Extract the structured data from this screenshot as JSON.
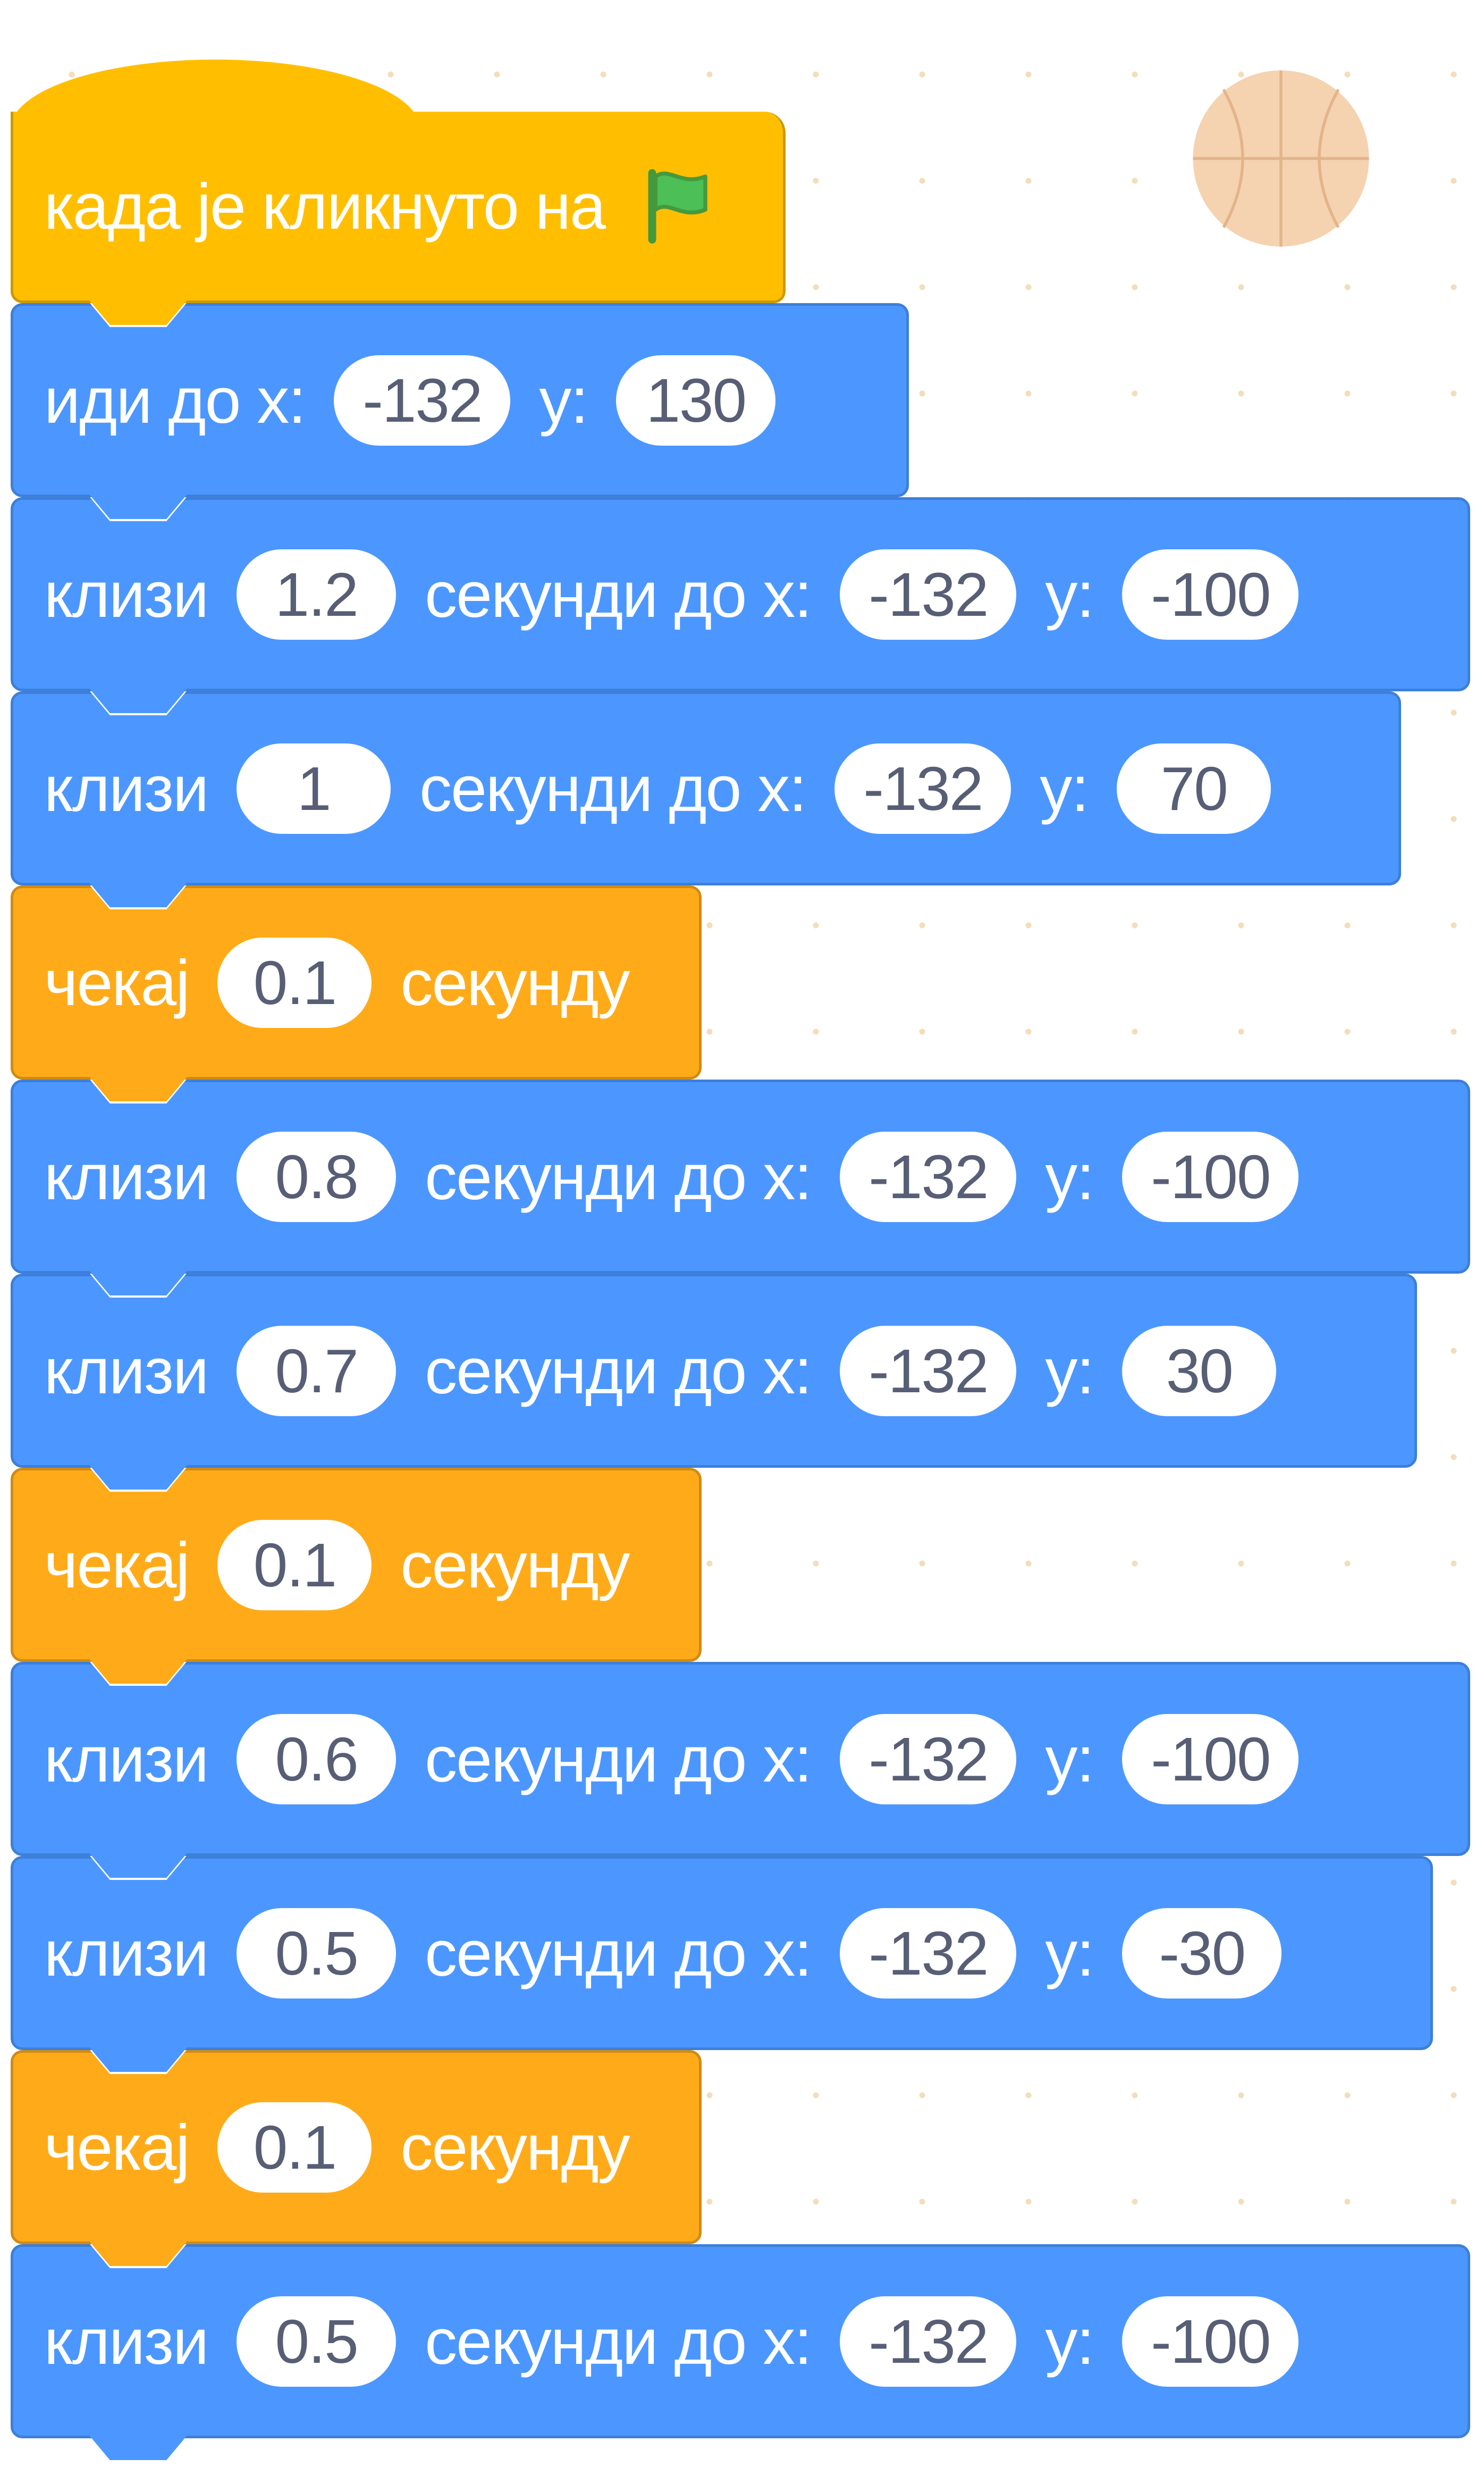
{
  "sprite_icon": "basketball-sprite-icon",
  "flag_icon": "green-flag-icon",
  "colors": {
    "motion": "#4c97ff",
    "control": "#ffab19",
    "events": "#ffbf00",
    "input_text": "#575e75"
  },
  "script": {
    "hat_label": "када је кликнуто на",
    "goto": {
      "label_x": "иди до x:",
      "x": "-132",
      "label_y": "y:",
      "y": "130"
    },
    "glides": [
      {
        "label": "клизи",
        "secs": "1.2",
        "label_to_x": "секунди до x:",
        "x": "-132",
        "label_y": "y:",
        "y": "-100"
      },
      {
        "label": "клизи",
        "secs": "1",
        "label_to_x": "секунди до x:",
        "x": "-132",
        "label_y": "y:",
        "y": "70"
      },
      {
        "label": "клизи",
        "secs": "0.8",
        "label_to_x": "секунди до x:",
        "x": "-132",
        "label_y": "y:",
        "y": "-100"
      },
      {
        "label": "клизи",
        "secs": "0.7",
        "label_to_x": "секунди до x:",
        "x": "-132",
        "label_y": "y:",
        "y": "30"
      },
      {
        "label": "клизи",
        "secs": "0.6",
        "label_to_x": "секунди до x:",
        "x": "-132",
        "label_y": "y:",
        "y": "-100"
      },
      {
        "label": "клизи",
        "secs": "0.5",
        "label_to_x": "секунди до x:",
        "x": "-132",
        "label_y": "y:",
        "y": "-30"
      },
      {
        "label": "клизи",
        "secs": "0.5",
        "label_to_x": "секунди до x:",
        "x": "-132",
        "label_y": "y:",
        "y": "-100"
      }
    ],
    "waits": [
      {
        "label": "чекај",
        "secs": "0.1",
        "unit": "секунду"
      },
      {
        "label": "чекај",
        "secs": "0.1",
        "unit": "секунду"
      },
      {
        "label": "чекај",
        "secs": "0.1",
        "unit": "секунду"
      }
    ]
  }
}
